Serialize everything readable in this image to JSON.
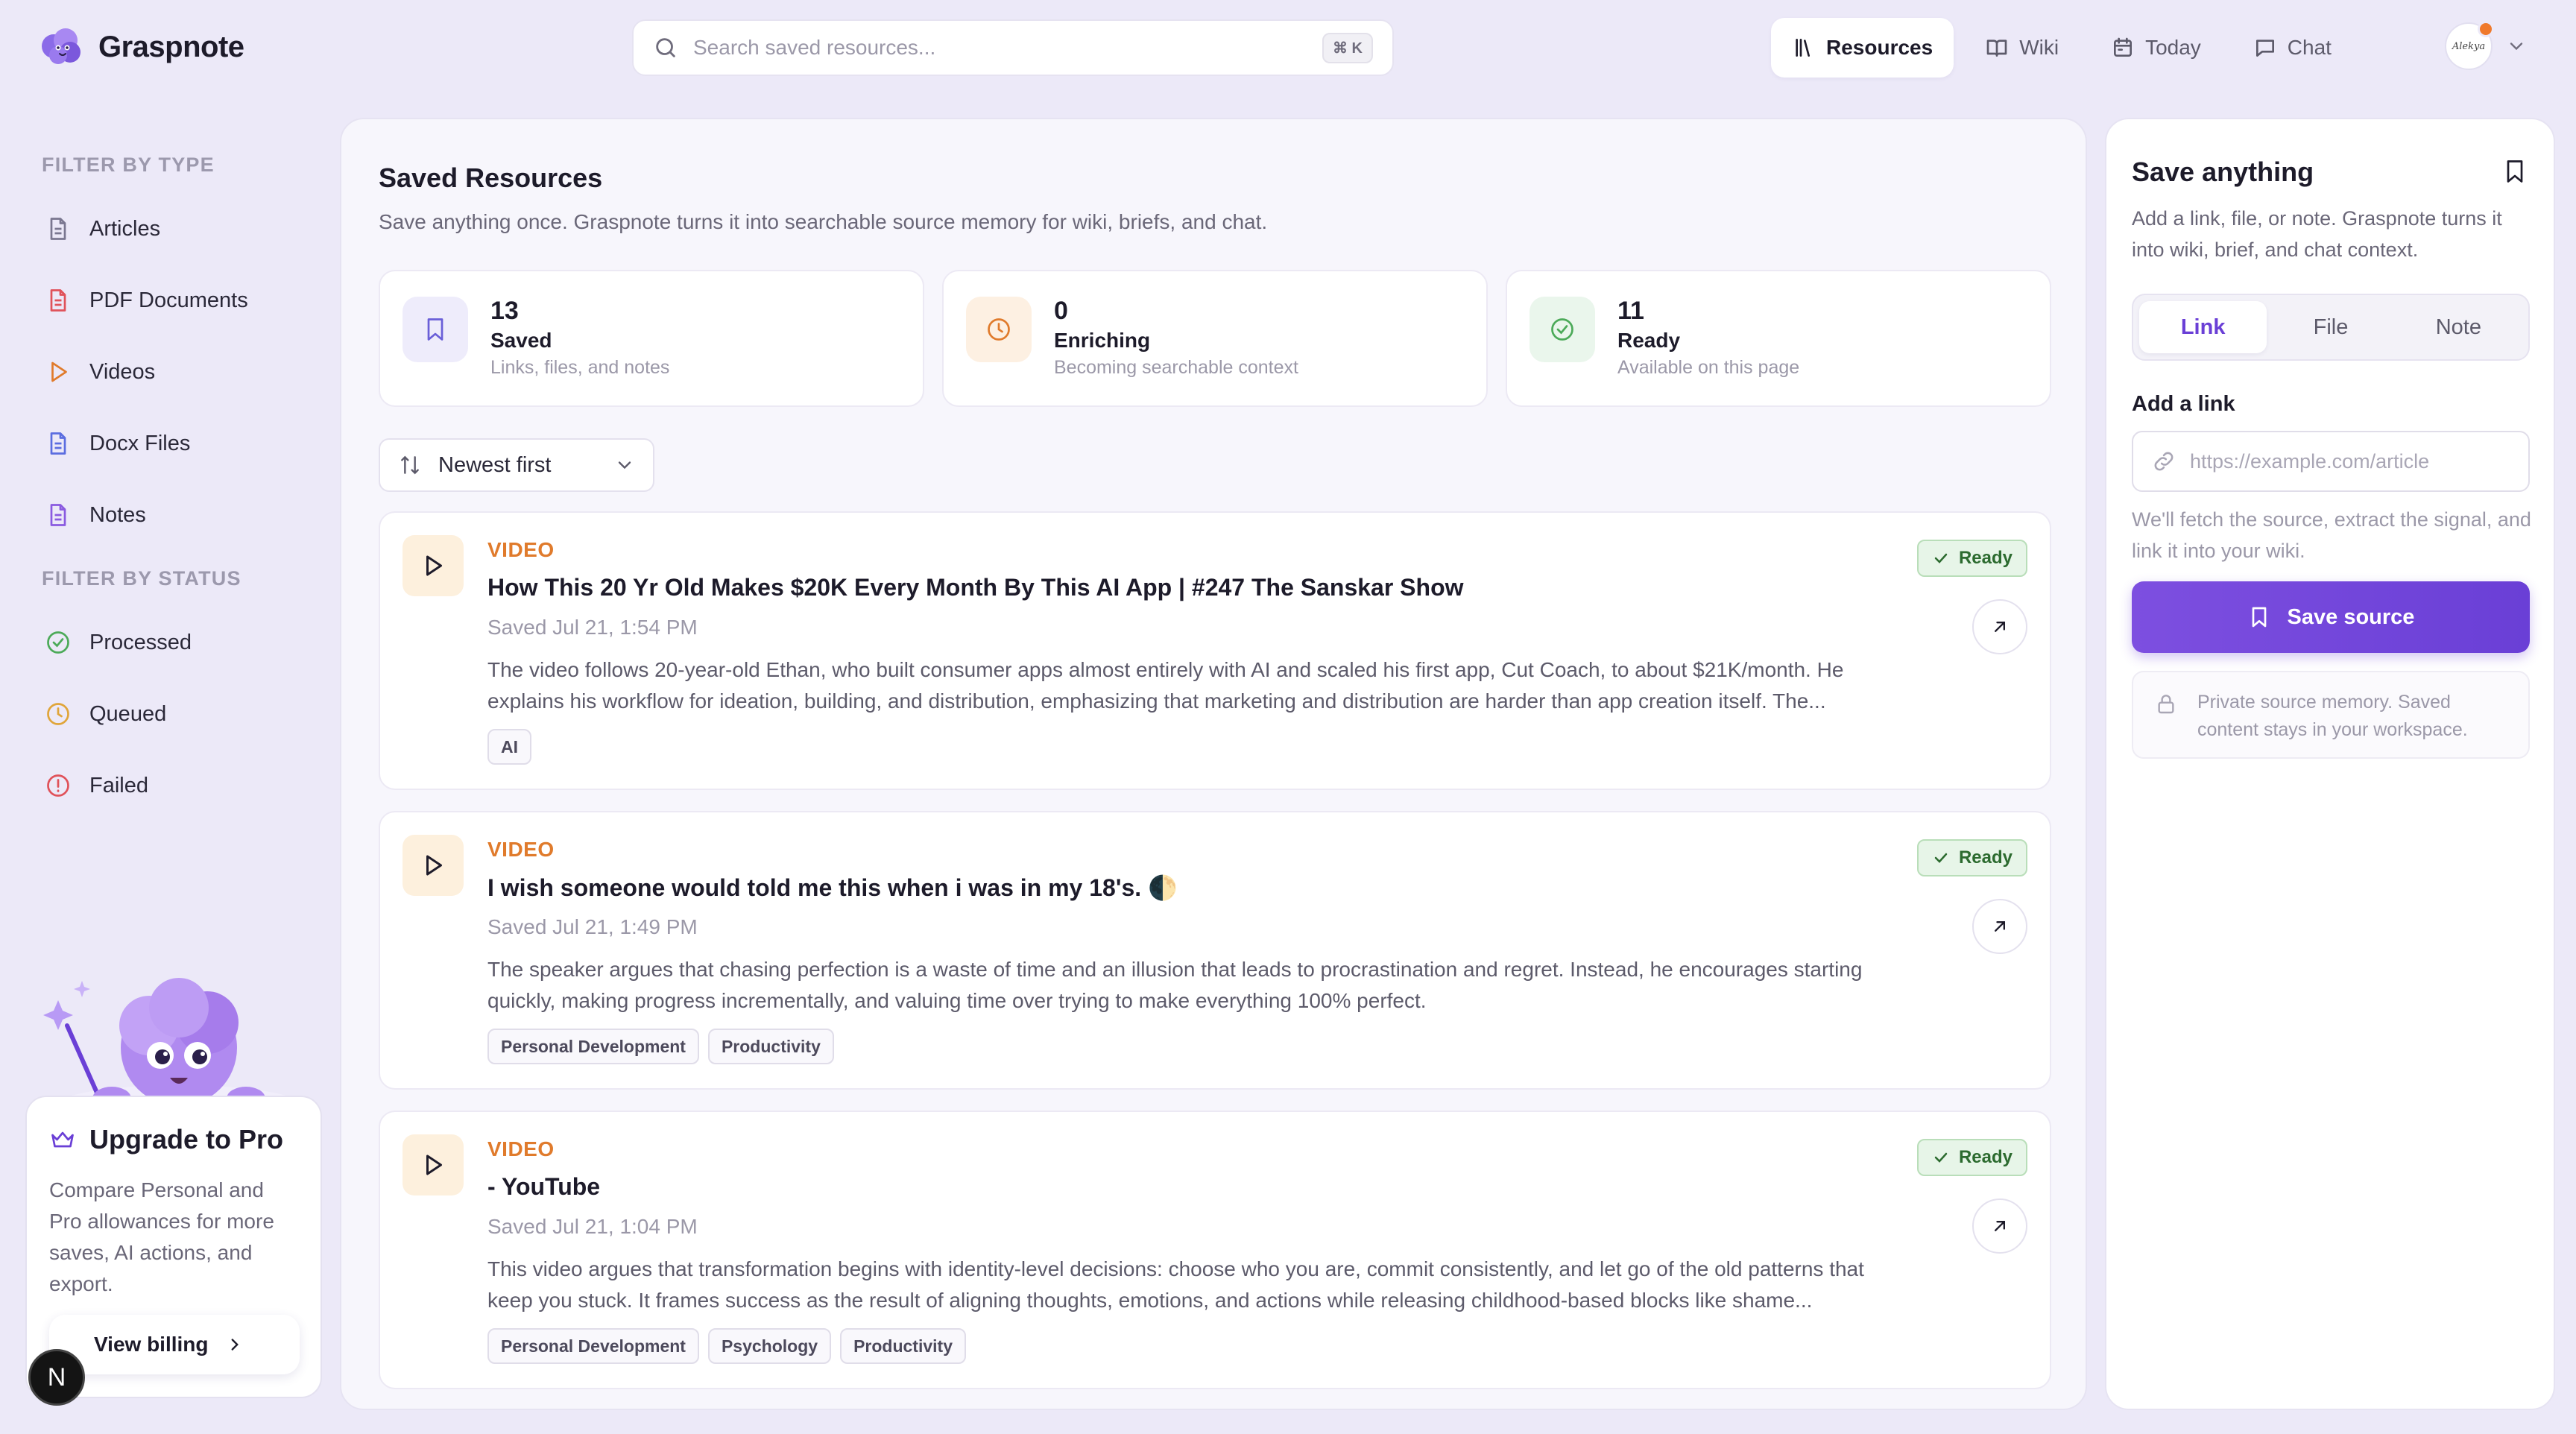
{
  "app": {
    "name": "Graspnote"
  },
  "search": {
    "placeholder": "Search saved resources...",
    "shortcut": "⌘ K"
  },
  "nav": {
    "items": [
      {
        "label": "Resources",
        "icon": "library-icon",
        "active": true
      },
      {
        "label": "Wiki",
        "icon": "book-icon",
        "active": false
      },
      {
        "label": "Today",
        "icon": "calendar-icon",
        "active": false
      },
      {
        "label": "Chat",
        "icon": "chat-icon",
        "active": false
      }
    ]
  },
  "user": {
    "avatar_text": "Alekya",
    "notification": true
  },
  "sidebar": {
    "type_heading": "FILTER BY TYPE",
    "types": [
      {
        "label": "Articles",
        "icon": "document-icon"
      },
      {
        "label": "PDF Documents",
        "icon": "pdf-icon"
      },
      {
        "label": "Videos",
        "icon": "play-icon"
      },
      {
        "label": "Docx Files",
        "icon": "docx-icon"
      },
      {
        "label": "Notes",
        "icon": "note-icon"
      }
    ],
    "status_heading": "FILTER BY STATUS",
    "statuses": [
      {
        "label": "Processed",
        "icon": "check-circle-icon"
      },
      {
        "label": "Queued",
        "icon": "clock-icon"
      },
      {
        "label": "Failed",
        "icon": "alert-circle-icon"
      }
    ]
  },
  "upgrade": {
    "title": "Upgrade to Pro",
    "text": "Compare Personal and Pro allowances for more saves, AI actions, and export.",
    "button_label": "View billing"
  },
  "dev_badge": "N",
  "main": {
    "title": "Saved Resources",
    "subtitle": "Save anything once. Graspnote turns it into searchable source memory for wiki, briefs, and chat.",
    "stats": [
      {
        "value": "13",
        "label": "Saved",
        "desc": "Links, files, and notes"
      },
      {
        "value": "0",
        "label": "Enriching",
        "desc": "Becoming searchable context"
      },
      {
        "value": "11",
        "label": "Ready",
        "desc": "Available on this page"
      }
    ],
    "sort_label": "Newest first",
    "cards": [
      {
        "type": "VIDEO",
        "title": "How This 20 Yr Old Makes $20K Every Month By This AI App | #247 The Sanskar Show",
        "date": "Saved Jul 21, 1:54 PM",
        "desc": "The video follows 20-year-old Ethan, who built consumer apps almost entirely with AI and scaled his first app, Cut Coach, to about $21K/month. He explains his workflow for ideation, building, and distribution, emphasizing that marketing and distribution are harder than app creation itself. The...",
        "tags": [
          "AI"
        ],
        "status": "Ready"
      },
      {
        "type": "VIDEO",
        "title": "I wish someone would told me this when i was in my 18's. 🌓",
        "date": "Saved Jul 21, 1:49 PM",
        "desc": "The speaker argues that chasing perfection is a waste of time and an illusion that leads to procrastination and regret. Instead, he encourages starting quickly, making progress incrementally, and valuing time over trying to make everything 100% perfect.",
        "tags": [
          "Personal Development",
          "Productivity"
        ],
        "status": "Ready"
      },
      {
        "type": "VIDEO",
        "title": "- YouTube",
        "date": "Saved Jul 21, 1:04 PM",
        "desc": "This video argues that transformation begins with identity-level decisions: choose who you are, commit consistently, and let go of the old patterns that keep you stuck. It frames success as the result of aligning thoughts, emotions, and actions while releasing childhood-based blocks like shame...",
        "tags": [
          "Personal Development",
          "Psychology",
          "Productivity"
        ],
        "status": "Ready"
      }
    ]
  },
  "save_panel": {
    "title": "Save anything",
    "subtitle": "Add a link, file, or note. Graspnote turns it into wiki, brief, and chat context.",
    "tabs": [
      {
        "label": "Link",
        "active": true
      },
      {
        "label": "File",
        "active": false
      },
      {
        "label": "Note",
        "active": false
      }
    ],
    "field_label": "Add a link",
    "url_placeholder": "https://example.com/article",
    "help": "We'll fetch the source, extract the signal, and link it into your wiki.",
    "button_label": "Save source",
    "privacy": "Private source memory. Saved content stays in your workspace."
  },
  "colors": {
    "accent": "#6a3fd6",
    "video_label": "#e07b2c",
    "ready_bg": "#e7f5e8",
    "ready_text": "#2c6b2f",
    "page_bg": "#ece9f8"
  }
}
